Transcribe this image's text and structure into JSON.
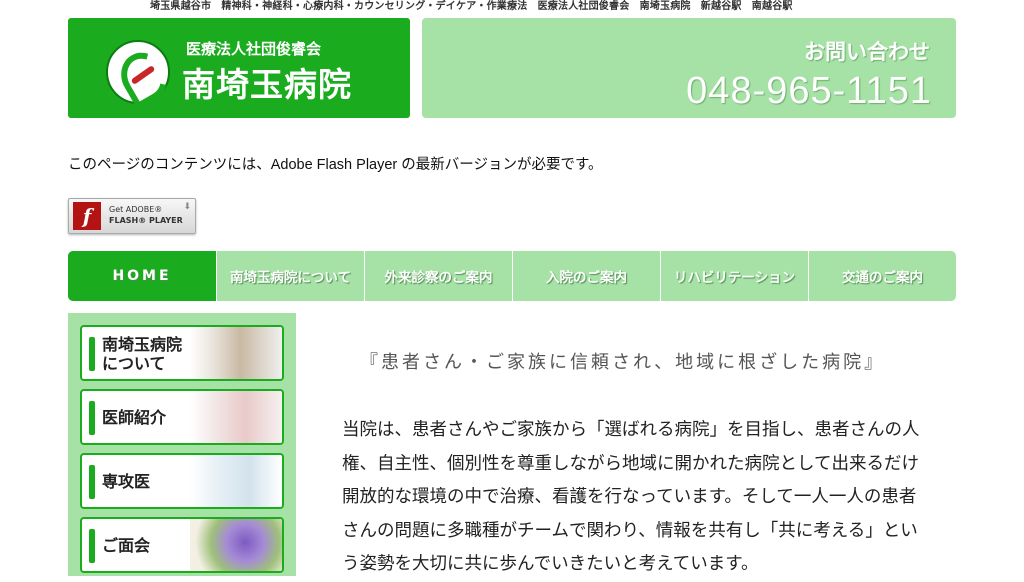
{
  "header": {
    "topline": "埼玉県越谷市　精神科・神経科・心療内科・カウンセリング・デイケア・作業療法　医療法人社団俊睿会　南埼玉病院　新越谷駅　南越谷駅",
    "org_name": "医療法人社団俊睿会",
    "hospital_name": "南埼玉病院",
    "contact_label": "お問い合わせ",
    "phone": "048-965-1151"
  },
  "flash": {
    "message": "このページのコンテンツには、Adobe Flash Player の最新バージョンが必要です。",
    "badge_line1": "Get ADOBE®",
    "badge_line2": "FLASH® PLAYER"
  },
  "nav": {
    "items": [
      {
        "label": "HOME"
      },
      {
        "label": "南埼玉病院について"
      },
      {
        "label": "外来診察のご案内"
      },
      {
        "label": "入院のご案内"
      },
      {
        "label": "リハビリテーション"
      },
      {
        "label": "交通のご案内"
      }
    ]
  },
  "sidebar": {
    "items": [
      {
        "label_line1": "南埼玉病院",
        "label_line2": "について"
      },
      {
        "label_line1": "医師紹介",
        "label_line2": ""
      },
      {
        "label_line1": "専攻医",
        "label_line2": ""
      },
      {
        "label_line1": "ご面会",
        "label_line2": ""
      }
    ]
  },
  "main": {
    "tagline": "『患者さん・ご家族に信頼され、地域に根ざした病院』",
    "paragraph": "当院は、患者さんやご家族から「選ばれる病院」を目指し、患者さんの人権、自主性、個別性を尊重しながら地域に開かれた病院として出来るだけ開放的な環境の中で治療、看護を行なっています。そして一人一人の患者さんの問題に多職種がチームで関わり、情報を共有し「共に考える」という姿勢を大切に共に歩んでいきたいと考えています。"
  },
  "colors": {
    "brand_green": "#1aab1e",
    "light_green": "#a6e1a6"
  }
}
